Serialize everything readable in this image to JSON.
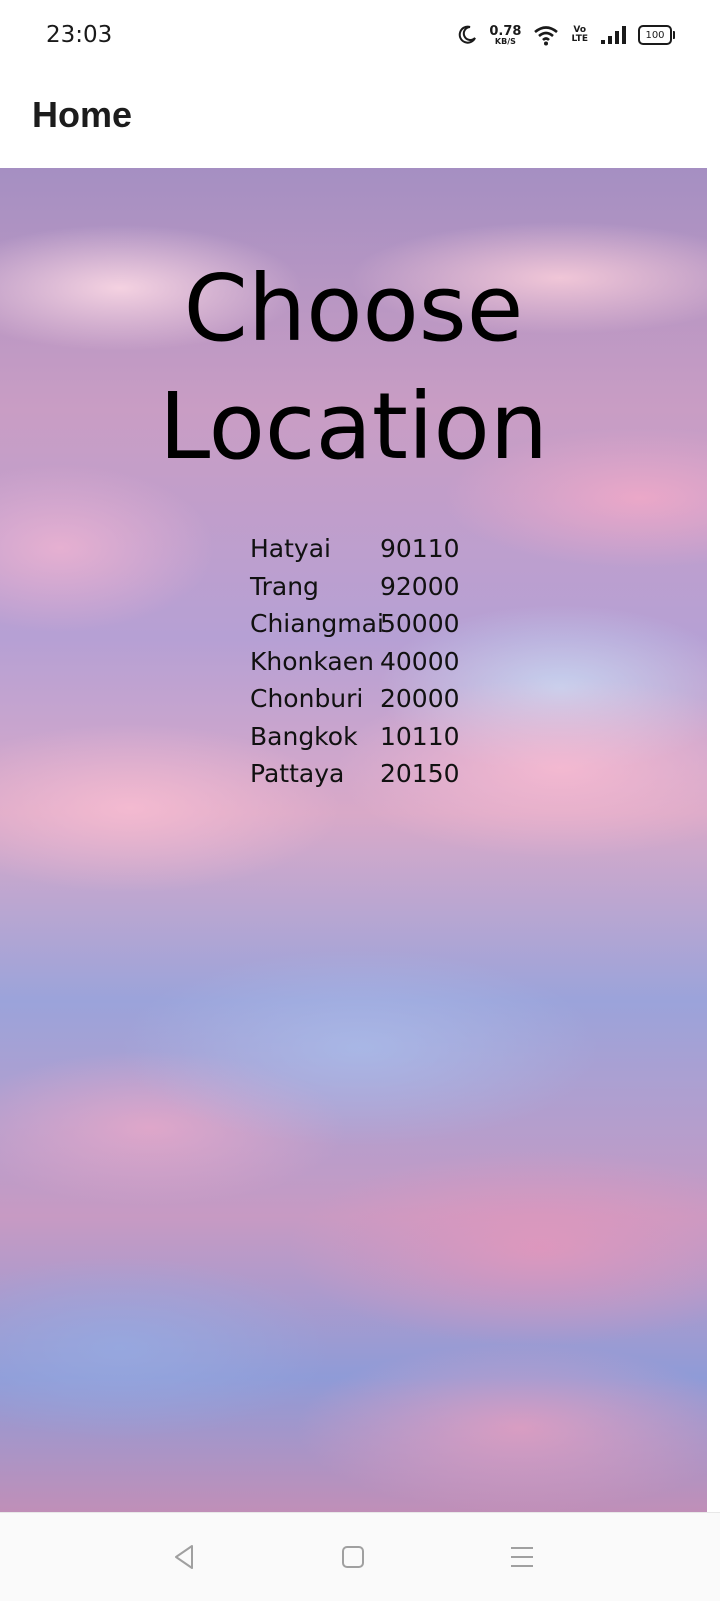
{
  "status_bar": {
    "time": "23:03",
    "net_speed_value": "0.78",
    "net_speed_unit": "KB/S",
    "volte_top": "Vo",
    "volte_bottom": "LTE",
    "battery": "100",
    "icons": [
      "moon-icon",
      "wifi-icon",
      "signal-icon",
      "battery-icon"
    ]
  },
  "app_bar": {
    "title": "Home"
  },
  "main": {
    "heading_line1": "Choose",
    "heading_line2": "Location",
    "locations": [
      {
        "name": "Hatyai",
        "code": "90110"
      },
      {
        "name": "Trang",
        "code": "92000"
      },
      {
        "name": "Chiangmai",
        "code": "50000"
      },
      {
        "name": "Khonkaen",
        "code": "40000"
      },
      {
        "name": "Chonburi",
        "code": "20000"
      },
      {
        "name": "Bangkok",
        "code": "10110"
      },
      {
        "name": "Pattaya",
        "code": "20150"
      }
    ]
  },
  "nav_bar": {
    "icons": [
      "back-icon",
      "home-icon",
      "menu-icon"
    ]
  }
}
